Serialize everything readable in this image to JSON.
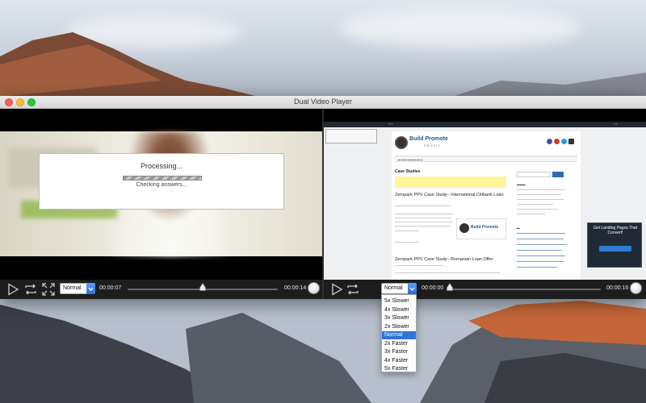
{
  "window": {
    "title": "Dual Video Player"
  },
  "left_player": {
    "dialog": {
      "title": "Processing...",
      "subtitle": "Checking answers..."
    },
    "speed": "Normal",
    "time_elapsed": "00:00:07",
    "time_total": "00:00:14",
    "progress": 0.5
  },
  "right_player": {
    "speed": "Normal",
    "time_elapsed": "00:00:00",
    "time_total": "00:00:16",
    "progress": 0.0,
    "webpage": {
      "logo_text": "Build Promote",
      "logo_sub": "PROFIT",
      "heading": "Case Studies",
      "post1_title": "Zeropark PPV Case Study– International Citibank Loan",
      "post2_title": "Zeropark PPV Case Study– Romanian Loan Offer",
      "box_logo_text": "Build Promote",
      "ad_text": "Get Landing Pages That Convert!"
    }
  },
  "speed_dropdown": {
    "options": [
      "5x Slower",
      "4x Slower",
      "3x Slower",
      "2x Slower",
      "Normal",
      "2x Faster",
      "3x Faster",
      "4x Faster",
      "5x Faster"
    ],
    "selected_index": 4
  },
  "colors": {
    "accent": "#2f74d6",
    "close": "#fc5f57",
    "minimize": "#fdbc2e",
    "maximize": "#28c840"
  }
}
